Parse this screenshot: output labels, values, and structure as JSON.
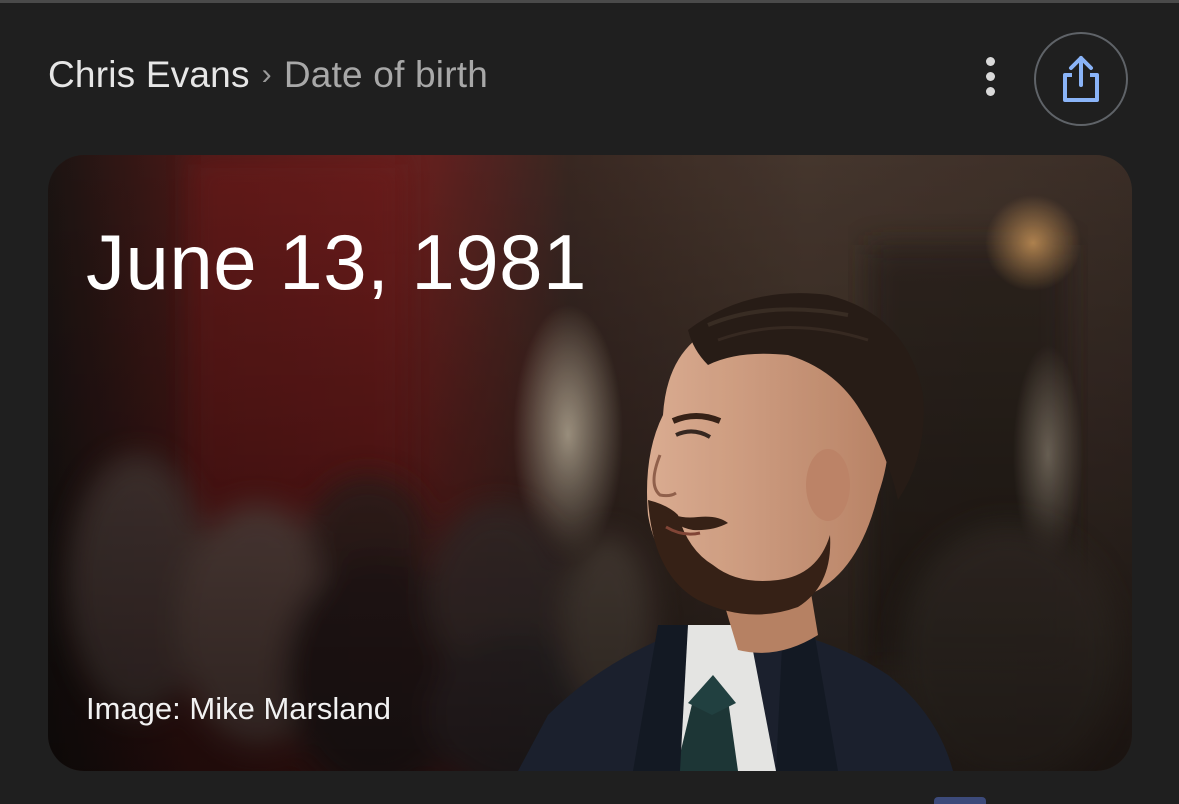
{
  "breadcrumb": {
    "root": "Chris Evans",
    "separator": "›",
    "current": "Date of birth"
  },
  "actions": {
    "more_icon": "more-vert-icon",
    "share_icon": "share-icon",
    "share_accent": "#8ab4f8"
  },
  "answer_card": {
    "date": "June 13, 1981",
    "image_credit": "Image: Mike Marsland"
  }
}
